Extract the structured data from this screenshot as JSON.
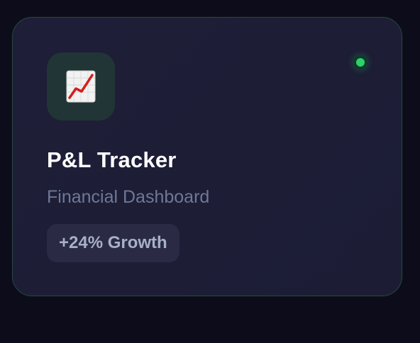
{
  "card": {
    "icon_name": "chart-increasing-icon",
    "title": "P&L Tracker",
    "subtitle": "Financial Dashboard",
    "badge": "+24% Growth",
    "status": {
      "icon_name": "online-status-dot",
      "color": "#2ed26a"
    }
  },
  "colors": {
    "background": "#0c0c1a",
    "card": "#1e1e38",
    "card_border": "#26463f",
    "icon_tile": "#223536",
    "badge_background": "#2a2a45",
    "title_text": "#ffffff",
    "subtitle_text": "#6f7896",
    "badge_text": "#a8b0c6"
  }
}
